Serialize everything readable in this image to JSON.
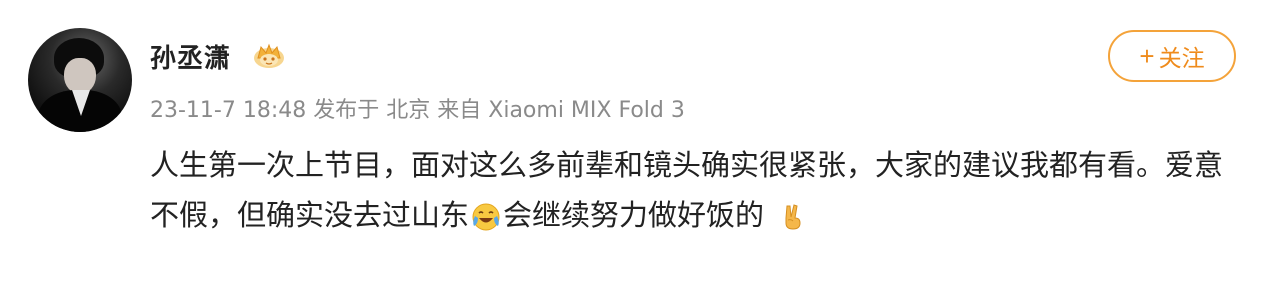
{
  "post": {
    "author": {
      "name": "孙丞潇",
      "badge_icon": "vip-crown-badge-icon"
    },
    "meta": {
      "timestamp": "23-11-7 18:48",
      "location": "发布于 北京",
      "source": "来自 Xiaomi MIX Fold 3"
    },
    "follow_button": {
      "plus": "+",
      "label": "关注"
    },
    "content": {
      "part1": "人生第一次上节目，面对这么多前辈和镜头确实很紧张，大家的建议我都有看。爱意不假，但确实没去过山东",
      "emoji1_icon": "laughing-crying-emoji-icon",
      "part2": "会继续努力做好饭的",
      "emoji2_icon": "victory-hand-emoji-icon"
    },
    "colors": {
      "accent": "#ef8b1c",
      "border": "#f4a33a",
      "meta_text": "#8a8a8a",
      "text": "#222222"
    }
  }
}
